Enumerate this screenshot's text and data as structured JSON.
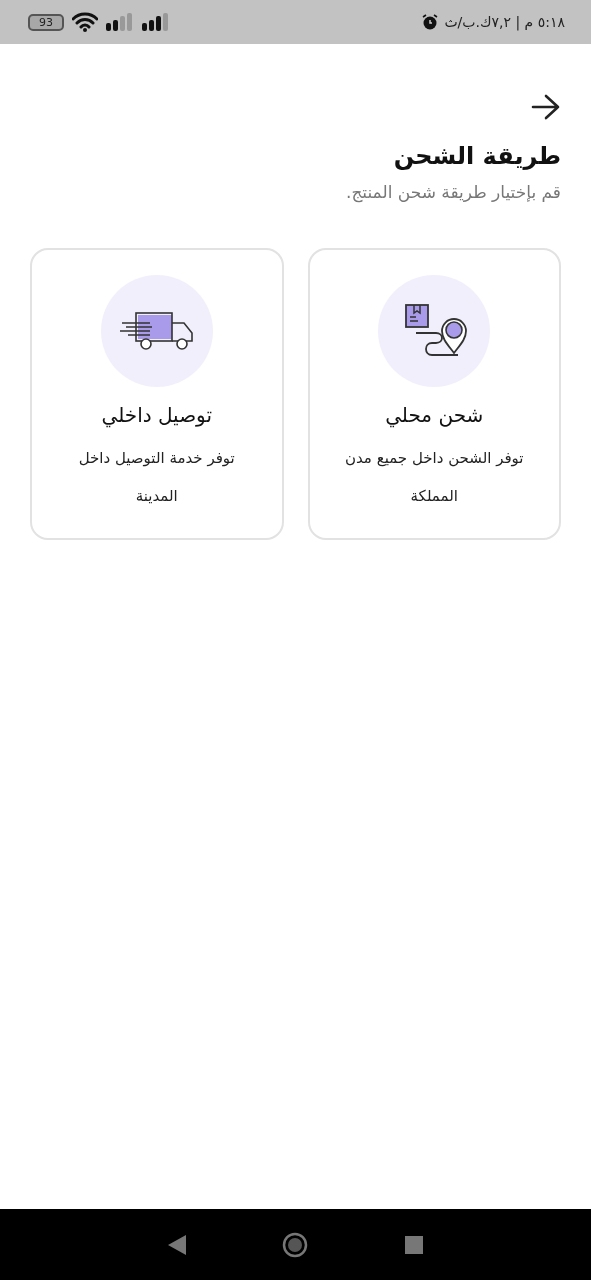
{
  "status_bar": {
    "time": "٥:١٨ م | ٧,٢ك.ب/ث",
    "battery": "93"
  },
  "header": {
    "title": "طريقة الشحن",
    "subtitle": "قم بإختيار طريقة شحن المنتج."
  },
  "options": [
    {
      "kind": "local",
      "title": "شحن محلي",
      "description": "توفر الشحن داخل جميع مدن المملكة"
    },
    {
      "kind": "delivery",
      "title": "توصيل داخلي",
      "description": "توفر خدمة التوصيل داخل المدينة"
    }
  ]
}
